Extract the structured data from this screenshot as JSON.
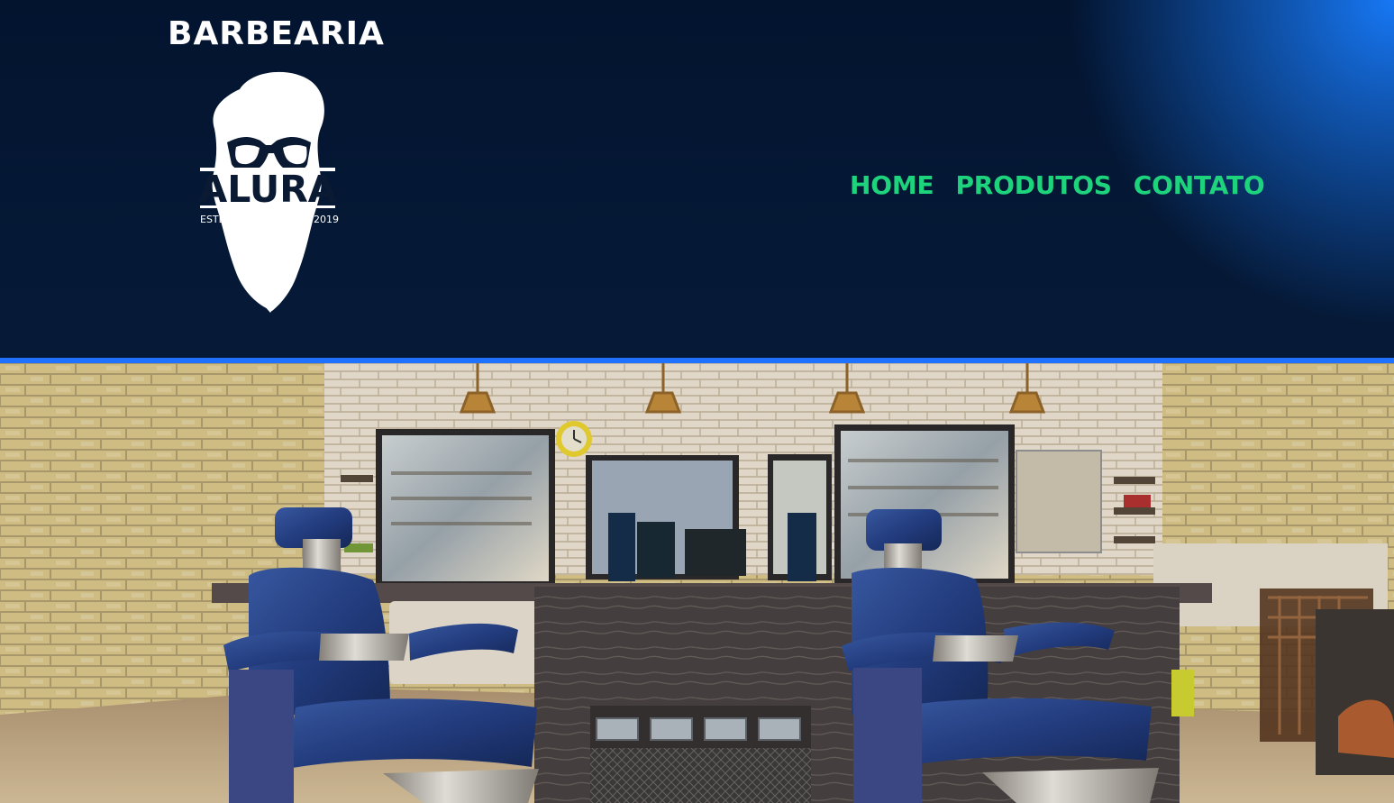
{
  "header": {
    "brand_name": "BARBEARIA",
    "logo": {
      "text": "ALURA",
      "left_text": "ESTD",
      "right_text": "2019"
    },
    "nav": [
      {
        "label": "HOME"
      },
      {
        "label": "PRODUTOS"
      },
      {
        "label": "CONTATO"
      }
    ],
    "colors": {
      "header_background": "#061a38",
      "nav_text": "#1dd47d",
      "divider": "#1f72ff"
    }
  },
  "hero": {
    "description_icon": "barbershop-photo"
  }
}
